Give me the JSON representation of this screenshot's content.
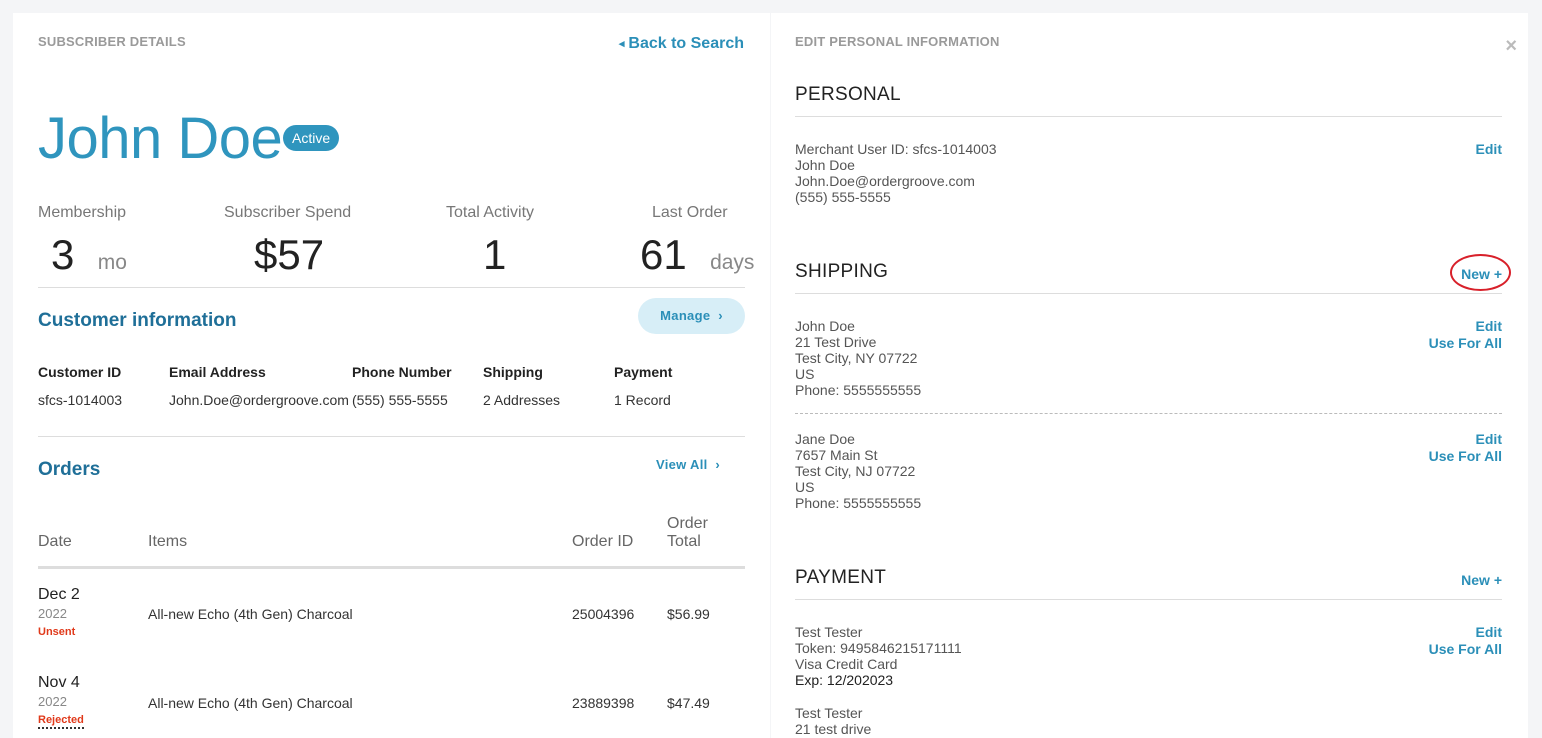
{
  "left": {
    "section_label": "SUBSCRIBER DETAILS",
    "back_label": "Back to Search",
    "back_chevron": "◂",
    "subscriber_name": "John Doe",
    "status_badge": "Active",
    "stats": {
      "membership": {
        "label": "Membership",
        "value": "3",
        "unit": "mo"
      },
      "spend": {
        "label": "Subscriber Spend",
        "value": "$57"
      },
      "activity": {
        "label": "Total Activity",
        "value": "1"
      },
      "last_order": {
        "label": "Last Order",
        "value": "61",
        "unit": "days"
      }
    },
    "customer_info": {
      "title": "Customer information",
      "manage_label": "Manage",
      "manage_chevron": "›",
      "headers": [
        "Customer ID",
        "Email Address",
        "Phone Number",
        "Shipping",
        "Payment"
      ],
      "values": [
        "sfcs-1014003",
        "John.Doe@ordergroove.com",
        "(555) 555-5555",
        "2 Addresses",
        "1 Record"
      ]
    },
    "orders": {
      "title": "Orders",
      "view_all_label": "View All",
      "view_all_chevron": "›",
      "headers": {
        "date": "Date",
        "items": "Items",
        "order_id": "Order ID",
        "order_total_line1": "Order",
        "order_total_line2": "Total"
      },
      "rows": [
        {
          "date": "Dec 2",
          "year": "2022",
          "status": "Unsent",
          "item": "All-new Echo (4th Gen) Charcoal",
          "order_id": "25004396",
          "total": "$56.99"
        },
        {
          "date": "Nov 4",
          "year": "2022",
          "status": "Rejected",
          "item": "All-new Echo (4th Gen) Charcoal",
          "order_id": "23889398",
          "total": "$47.49"
        }
      ]
    }
  },
  "right": {
    "section_label": "EDIT PERSONAL INFORMATION",
    "close_symbol": "×",
    "personal": {
      "title": "PERSONAL",
      "edit_label": "Edit",
      "lines": [
        "Merchant User ID: sfcs-1014003",
        "John Doe",
        "John.Doe@ordergroove.com",
        "(555) 555-5555"
      ]
    },
    "shipping": {
      "title": "SHIPPING",
      "new_label": "New +",
      "addresses": [
        {
          "lines": [
            "John Doe",
            "21 Test Drive",
            "Test City, NY 07722",
            "US",
            "Phone: 5555555555"
          ],
          "edit_label": "Edit",
          "use_all_label": "Use For All"
        },
        {
          "lines": [
            "Jane Doe",
            "7657 Main St",
            "Test City, NJ 07722",
            "US",
            "Phone: 5555555555"
          ],
          "edit_label": "Edit",
          "use_all_label": "Use For All"
        }
      ]
    },
    "payment": {
      "title": "PAYMENT",
      "new_label": "New +",
      "records": [
        {
          "lines": [
            "Test Tester",
            "Token: 9495846215171111",
            "Visa Credit Card"
          ],
          "exp": "Exp: 12/202023",
          "edit_label": "Edit",
          "use_all_label": "Use For All"
        },
        {
          "lines": [
            "Test Tester",
            "21 test drive"
          ]
        }
      ]
    }
  },
  "colors": {
    "accent": "#2f95be",
    "link": "#2b8fb8",
    "title_blue": "#1f6f98",
    "status_red": "#e0391a",
    "highlight_circle": "#d8202a"
  }
}
